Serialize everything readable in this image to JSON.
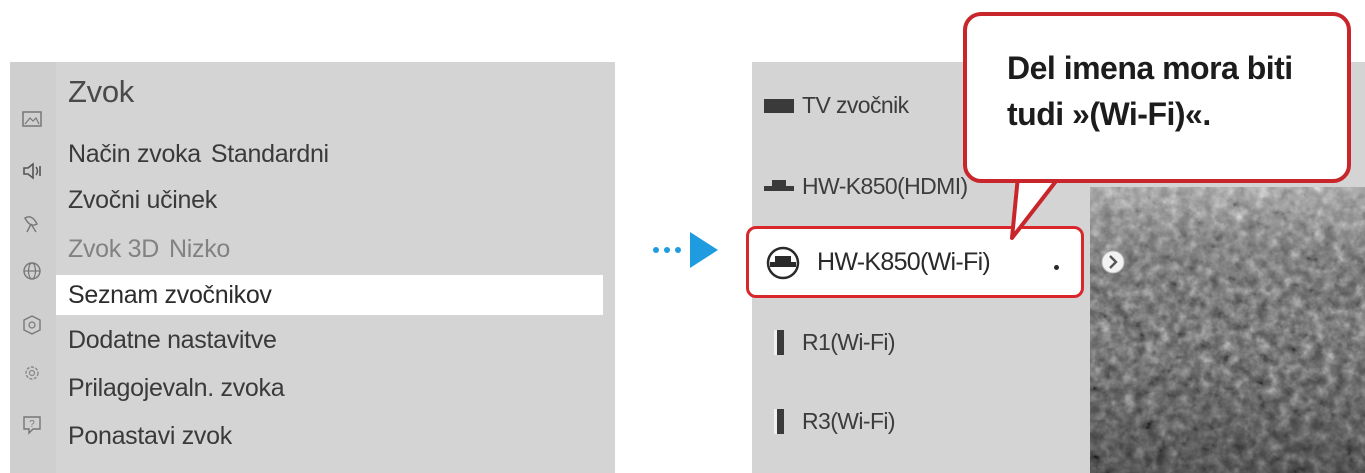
{
  "sound_menu": {
    "title": "Zvok",
    "items": [
      {
        "label": "Način zvoka",
        "value": "Standardni"
      },
      {
        "label": "Zvočni učinek",
        "value": ""
      },
      {
        "label": "Zvok 3D",
        "value": "Nizko"
      },
      {
        "label": "Seznam zvočnikov",
        "value": ""
      },
      {
        "label": "Dodatne nastavitve",
        "value": ""
      },
      {
        "label": "Prilagojevaln. zvoka",
        "value": ""
      },
      {
        "label": "Ponastavi zvok",
        "value": ""
      }
    ]
  },
  "sidebar_icons": [
    "picture-icon",
    "sound-icon",
    "broadcast-icon",
    "network-icon",
    "system-icon",
    "settings-icon",
    "support-icon"
  ],
  "speaker_list": {
    "items": [
      {
        "label": "TV zvočnik",
        "icon": "tv-icon"
      },
      {
        "label": "HW-K850(HDMI)",
        "icon": "soundbar-icon"
      },
      {
        "label": "HW-K850(Wi-Fi)",
        "icon": "wifi-speaker-icon",
        "highlighted": true
      },
      {
        "label": "R1(Wi-Fi)",
        "icon": "speaker-icon"
      },
      {
        "label": "R3(Wi-Fi)",
        "icon": "speaker-icon"
      }
    ]
  },
  "callout": {
    "line1": "Del imena mora biti",
    "line2": "tudi »(Wi-Fi)«."
  },
  "colors": {
    "panel_bg": "#d4d4d4",
    "highlight_red": "#d9262b",
    "arrow_blue": "#1f9be0"
  }
}
